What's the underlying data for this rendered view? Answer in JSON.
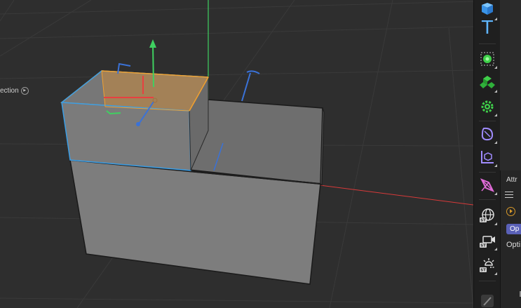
{
  "viewport": {
    "view_label": "ection"
  },
  "palette": {
    "tools": [
      {
        "name": "cube-icon",
        "color": "#4aa8ff"
      },
      {
        "name": "text-icon",
        "glyph": "T",
        "color": "#5fb6ff"
      },
      {
        "name": "mograph-cloner-icon",
        "color": "#3fcf4a"
      },
      {
        "name": "mograph-cluster-icon",
        "color": "#3fcf4a"
      },
      {
        "name": "effector-gear-icon",
        "color": "#3fcf4a"
      },
      {
        "name": "deformer-icon",
        "color": "#8f7cff"
      },
      {
        "name": "field-icon",
        "color": "#8f7cff"
      },
      {
        "name": "spline-pen-icon",
        "color": "#e06bd8"
      },
      {
        "name": "sky-globe-icon",
        "color": "#e0e0e0"
      },
      {
        "name": "camera-icon",
        "color": "#e0e0e0"
      },
      {
        "name": "light-icon",
        "color": "#e0e0e0"
      },
      {
        "name": "brush-icon",
        "color": "#888888"
      }
    ],
    "badge_text": "ST"
  },
  "attributes": {
    "tab_label": "Attr",
    "mode_pill": "Op",
    "options_label": "Opti"
  },
  "colors": {
    "selection": "#f0a030",
    "highlight": "#3a9ee6",
    "axis_x": "#e84040",
    "axis_y": "#3fd060",
    "axis_z": "#3a72d8"
  }
}
